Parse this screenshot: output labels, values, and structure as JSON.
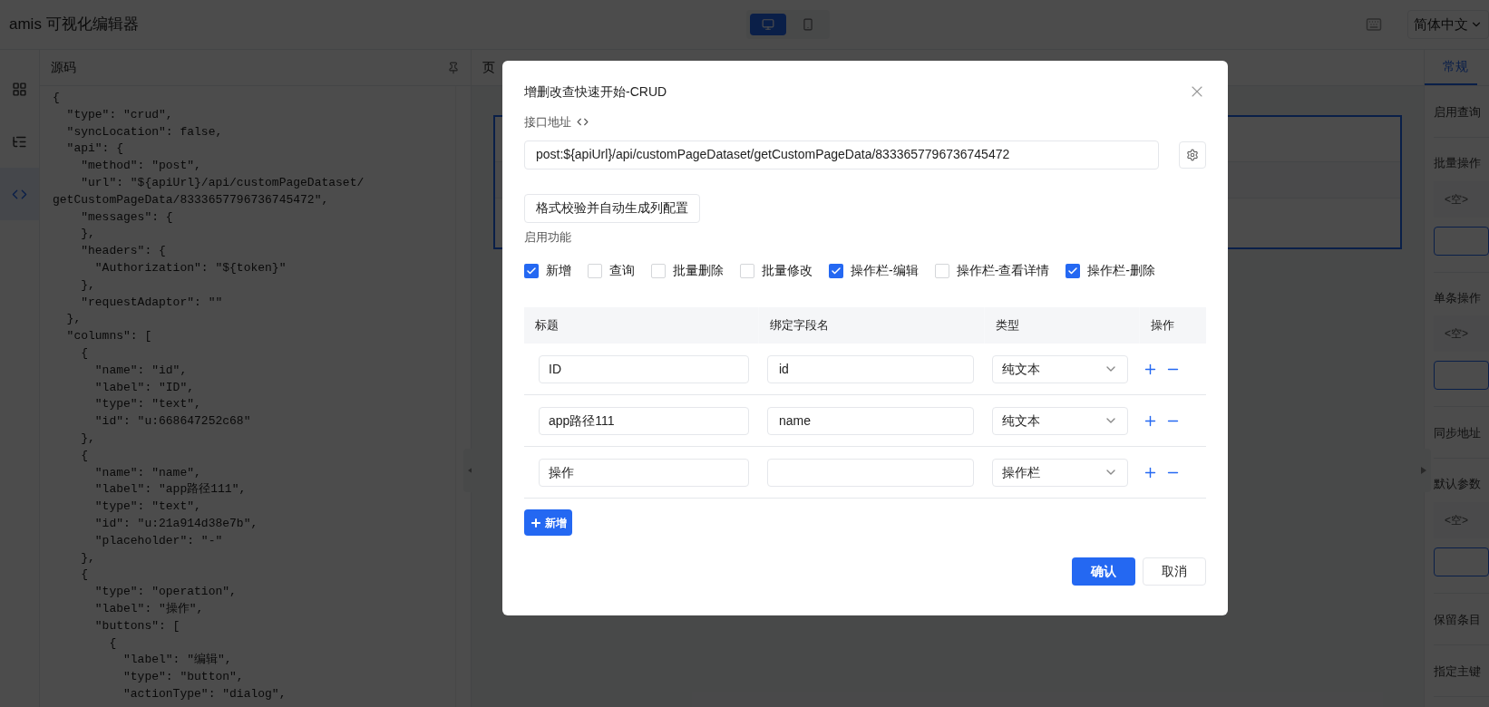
{
  "header": {
    "title": "amis 可视化编辑器",
    "devices": [
      {
        "kind": "desktop",
        "selected": true
      },
      {
        "kind": "mobile",
        "selected": false
      }
    ],
    "language": "简体中文"
  },
  "rail": [
    {
      "kind": "components",
      "selected": false
    },
    {
      "kind": "outline",
      "selected": false
    },
    {
      "kind": "code",
      "selected": true
    }
  ],
  "code_panel": {
    "title": "源码",
    "lines": [
      "{",
      "  \"type\": \"crud\",",
      "  \"syncLocation\": false,",
      "  \"api\": {",
      "    \"method\": \"post\",",
      "    \"url\": \"${apiUrl}/api/customPageDataset/",
      "getCustomPageData/8333657796736745472\",",
      "    \"messages\": {",
      "    },",
      "    \"headers\": {",
      "      \"Authorization\": \"${token}\"",
      "    },",
      "    \"requestAdaptor\": \"\"",
      "  },",
      "  \"columns\": [",
      "    {",
      "      \"name\": \"id\",",
      "      \"label\": \"ID\",",
      "      \"type\": \"text\",",
      "      \"id\": \"u:668647252c68\"",
      "    },",
      "    {",
      "      \"name\": \"name\",",
      "      \"label\": \"app路径111\",",
      "      \"type\": \"text\",",
      "      \"id\": \"u:21a914d38e7b\",",
      "      \"placeholder\": \"-\"",
      "    },",
      "    {",
      "      \"type\": \"operation\",",
      "      \"label\": \"操作\",",
      "      \"buttons\": [",
      "        {",
      "          \"label\": \"编辑\",",
      "          \"type\": \"button\",",
      "          \"actionType\": \"dialog\","
    ]
  },
  "canvas": {
    "tab": "页"
  },
  "settings": {
    "tab": {
      "label": "常规",
      "selected": true
    },
    "items": [
      {
        "kind": "switch",
        "label": "启用查询"
      },
      {
        "kind": "list",
        "label": "批量操作",
        "empty": "<空>"
      },
      {
        "kind": "list",
        "label": "单条操作",
        "empty": "<空>"
      },
      {
        "kind": "switch",
        "label": "同步地址"
      },
      {
        "kind": "list",
        "label": "默认参数",
        "empty": "<空>"
      },
      {
        "kind": "switch",
        "label": "保留条目"
      },
      {
        "kind": "switch",
        "label": "指定主键"
      }
    ]
  },
  "dialog": {
    "title": "增删改查快速开始-CRUD",
    "api_label": "接口地址",
    "api_value": "post:${apiUrl}/api/customPageDataset/getCustomPageData/8333657796736745472",
    "generate_button": "格式校验并自动生成列配置",
    "features_label": "启用功能",
    "features": [
      {
        "label": "新增",
        "checked": true
      },
      {
        "label": "查询",
        "checked": false
      },
      {
        "label": "批量删除",
        "checked": false
      },
      {
        "label": "批量修改",
        "checked": false
      },
      {
        "label": "操作栏-编辑",
        "checked": true
      },
      {
        "label": "操作栏-查看详情",
        "checked": false
      },
      {
        "label": "操作栏-删除",
        "checked": true
      }
    ],
    "columns": [
      "标题",
      "绑定字段名",
      "类型",
      "操作"
    ],
    "rows": [
      {
        "title": "ID",
        "field": "id",
        "type": "纯文本"
      },
      {
        "title": "app路径111",
        "field": "name",
        "type": "纯文本"
      },
      {
        "title": "操作",
        "field": "",
        "type": "操作栏"
      }
    ],
    "add_button": "新增",
    "confirm": "确认",
    "cancel": "取消"
  }
}
